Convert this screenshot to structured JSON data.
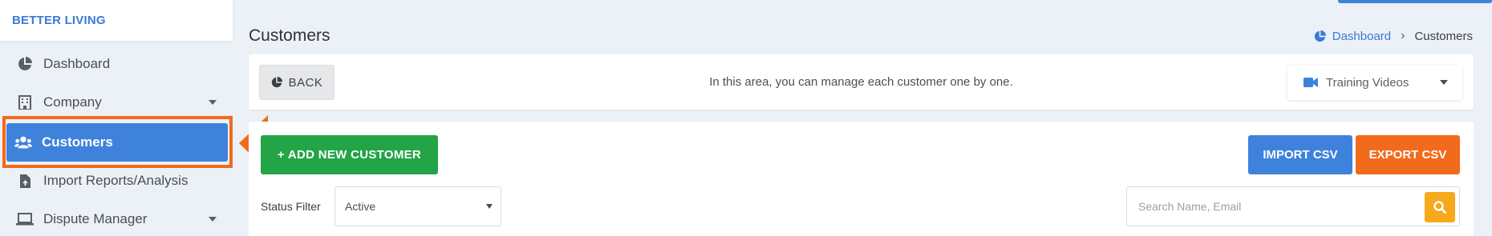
{
  "sidebar": {
    "brand": "BETTER LIVING",
    "items": [
      {
        "label": "Dashboard",
        "icon": "pie-chart-icon"
      },
      {
        "label": "Company",
        "icon": "building-icon",
        "has_caret": true
      },
      {
        "label": "Customers",
        "icon": "users-icon",
        "active": true
      },
      {
        "label": "Import Reports/Analysis",
        "icon": "file-upload-icon"
      },
      {
        "label": "Dispute Manager",
        "icon": "laptop-icon",
        "has_caret": true
      }
    ]
  },
  "header": {
    "title": "Customers",
    "breadcrumb": {
      "home": "Dashboard",
      "current": "Customers"
    }
  },
  "info_bar": {
    "back_label": "BACK",
    "message": "In this area, you can manage each customer one by one.",
    "training_label": "Training Videos"
  },
  "actions": {
    "add_label": "+ ADD NEW CUSTOMER",
    "import_label": "IMPORT CSV",
    "export_label": "EXPORT CSV"
  },
  "filters": {
    "status_label": "Status Filter",
    "status_value": "Active",
    "search_placeholder": "Search Name, Email"
  },
  "colors": {
    "accent": "#3f82dc",
    "success": "#22a447",
    "warning": "#f26a1b",
    "search": "#f7a91c"
  }
}
